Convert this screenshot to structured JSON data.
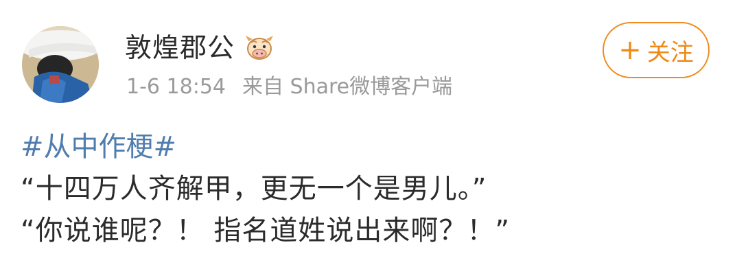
{
  "post": {
    "author": {
      "name": "敦煌郡公",
      "badge_icon": "cow-emoji-badge-icon",
      "avatar_icon": "user-avatar-photo"
    },
    "meta": {
      "time": "1-6 18:54",
      "source": "来自 Share微博客户端"
    },
    "follow_button": {
      "plus": "+",
      "label": "关注"
    },
    "topic": "#从中作梗#",
    "content_lines": [
      "“十四万人齐解甲，更无一个是男儿。”",
      "“你说谁呢？！ 指名道姓说出来啊？！”"
    ]
  },
  "colors": {
    "accent_orange": "#ee8a16",
    "topic_blue": "#507daf",
    "meta_gray": "#9a9a9a",
    "text_dark": "#2b2b2b"
  }
}
